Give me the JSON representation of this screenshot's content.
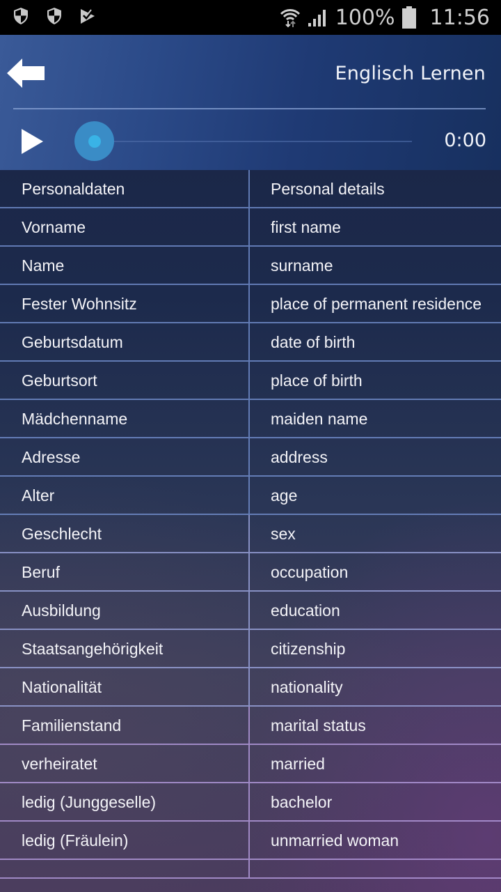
{
  "status_bar": {
    "left_icons": [
      "shield-icon",
      "shield-icon",
      "play-store-check-icon"
    ],
    "right_icons": [
      "wifi-icon",
      "signal-icon",
      "battery-icon"
    ],
    "battery_percent": "100%",
    "time": "11:56"
  },
  "header": {
    "back_icon": "arrow-left-icon",
    "title": "Englisch Lernen"
  },
  "player": {
    "play_icon": "play-icon",
    "progress_fraction": 0.0,
    "time": "0:00"
  },
  "vocab": {
    "rows": [
      {
        "de": "Personaldaten",
        "en": "Personal details"
      },
      {
        "de": "Vorname",
        "en": "first name"
      },
      {
        "de": "Name",
        "en": "surname"
      },
      {
        "de": "Fester Wohnsitz",
        "en": "place of permanent residence"
      },
      {
        "de": "Geburtsdatum",
        "en": "date of birth"
      },
      {
        "de": "Geburtsort",
        "en": "place of birth"
      },
      {
        "de": "Mädchenname",
        "en": "maiden name"
      },
      {
        "de": "Adresse",
        "en": "address"
      },
      {
        "de": "Alter",
        "en": "age"
      },
      {
        "de": "Geschlecht",
        "en": "sex"
      },
      {
        "de": "Beruf",
        "en": "occupation"
      },
      {
        "de": "Ausbildung",
        "en": "education"
      },
      {
        "de": "Staatsangehörigkeit",
        "en": "citizenship"
      },
      {
        "de": "Nationalität",
        "en": "nationality"
      },
      {
        "de": "Familienstand",
        "en": "marital status"
      },
      {
        "de": "verheiratet",
        "en": "married"
      },
      {
        "de": "ledig (Junggeselle)",
        "en": "bachelor"
      },
      {
        "de": "ledig (Fräulein)",
        "en": "unmarried woman"
      },
      {
        "de": "",
        "en": ""
      }
    ]
  },
  "colors": {
    "accent": "#39b3e6",
    "seek_thumb": "#3a8cc6",
    "header_bg": "#2b4a88"
  }
}
